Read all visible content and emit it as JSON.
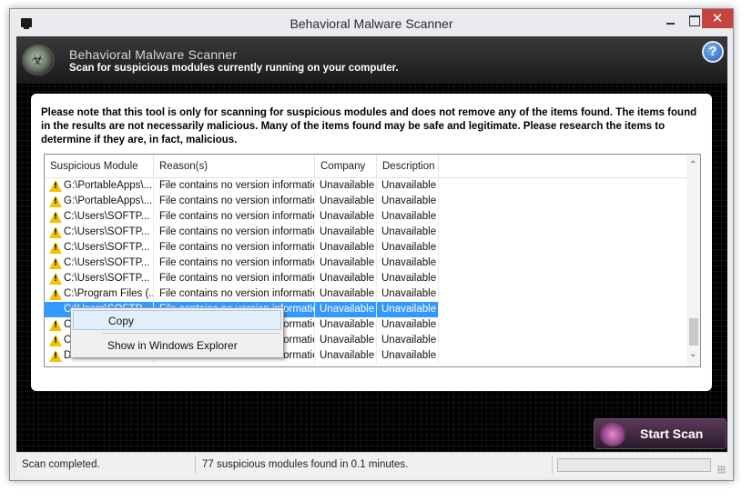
{
  "window": {
    "title": "Behavioral Malware Scanner",
    "close_glyph": "✕"
  },
  "header": {
    "title": "Behavioral Malware Scanner",
    "subtitle": "Scan for suspicious modules currently running on your computer.",
    "help_glyph": "?"
  },
  "notice": "Please note that this tool is only for scanning for suspicious modules and does not remove any of the items found. The items found in the results are not necessarily malicious. Many of the items found may be safe and legitimate. Please research the items to determine if they are, in fact, malicious.",
  "list": {
    "columns": [
      "Suspicious Module",
      "Reason(s)",
      "Company",
      "Description"
    ],
    "rows": [
      {
        "module": "G:\\PortableApps\\...",
        "reason": "File contains no version information",
        "company": "Unavailable",
        "description": "Unavailable"
      },
      {
        "module": "G:\\PortableApps\\...",
        "reason": "File contains no version information",
        "company": "Unavailable",
        "description": "Unavailable"
      },
      {
        "module": "C:\\Users\\SOFTP...",
        "reason": "File contains no version information",
        "company": "Unavailable",
        "description": "Unavailable"
      },
      {
        "module": "C:\\Users\\SOFTP...",
        "reason": "File contains no version information",
        "company": "Unavailable",
        "description": "Unavailable"
      },
      {
        "module": "C:\\Users\\SOFTP...",
        "reason": "File contains no version information",
        "company": "Unavailable",
        "description": "Unavailable"
      },
      {
        "module": "C:\\Users\\SOFTP...",
        "reason": "File contains no version information",
        "company": "Unavailable",
        "description": "Unavailable"
      },
      {
        "module": "C:\\Users\\SOFTP...",
        "reason": "File contains no version information",
        "company": "Unavailable",
        "description": "Unavailable"
      },
      {
        "module": "C:\\Program Files (...",
        "reason": "File contains no version information",
        "company": "Unavailable",
        "description": "Unavailable"
      },
      {
        "module": "C:\\Users\\SOFTP...",
        "reason": "File contains no version information",
        "company": "Unavailable",
        "description": "Unavailable"
      },
      {
        "module": "C:\\",
        "reason": "File contains no version information",
        "company": "Unavailable",
        "description": "Unavailable"
      },
      {
        "module": "C:\\",
        "reason": "File contains no version information",
        "company": "Unavailable",
        "description": "Unavailable"
      },
      {
        "module": "D:",
        "reason": "File contains no version information",
        "company": "Unavailable",
        "description": "Unavailable"
      }
    ],
    "scroll_up": "⌃",
    "scroll_down": "⌄"
  },
  "context_menu": {
    "copy": "Copy",
    "show": "Show in Windows Explorer"
  },
  "scan_button": "Start Scan",
  "status": {
    "left": "Scan completed.",
    "middle": "77 suspicious modules found in 0.1 minutes."
  },
  "colors": {
    "selection": "#3399ff",
    "close_button": "#c7443e",
    "warning": "#f2c200"
  },
  "icons": [
    "app-icon",
    "biohazard-logo-icon",
    "help-icon",
    "warning-icon",
    "size-grip-icon"
  ]
}
